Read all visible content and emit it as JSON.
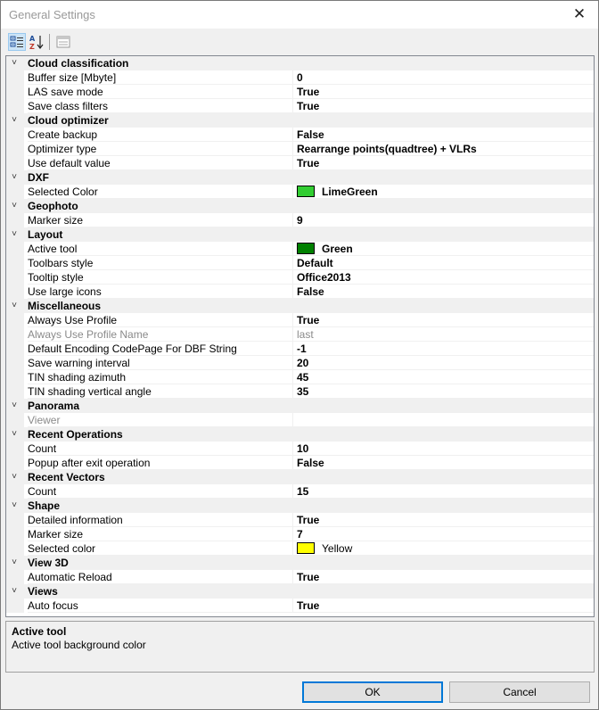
{
  "window": {
    "title": "General Settings"
  },
  "toolbar": {
    "categorized_tooltip": "",
    "alphabetical_tooltip": "",
    "pages_tooltip": ""
  },
  "categories": [
    {
      "name": "Cloud classification",
      "props": [
        {
          "name": "Buffer size [Mbyte]",
          "value": "0"
        },
        {
          "name": "LAS save mode",
          "value": "True"
        },
        {
          "name": "Save class filters",
          "value": "True"
        }
      ]
    },
    {
      "name": "Cloud optimizer",
      "props": [
        {
          "name": "Create backup",
          "value": "False"
        },
        {
          "name": "Optimizer type",
          "value": "Rearrange points(quadtree) + VLRs"
        },
        {
          "name": "Use default value",
          "value": "True"
        }
      ]
    },
    {
      "name": "DXF",
      "props": [
        {
          "name": "Selected Color",
          "value": "LimeGreen",
          "color": "#32cd32"
        }
      ]
    },
    {
      "name": "Geophoto",
      "props": [
        {
          "name": "Marker size",
          "value": "9"
        }
      ]
    },
    {
      "name": "Layout",
      "props": [
        {
          "name": "Active tool",
          "value": "Green",
          "color": "#008000"
        },
        {
          "name": "Toolbars style",
          "value": "Default"
        },
        {
          "name": "Tooltip style",
          "value": "Office2013"
        },
        {
          "name": "Use large icons",
          "value": "False"
        }
      ]
    },
    {
      "name": "Miscellaneous",
      "props": [
        {
          "name": "Always Use Profile",
          "value": "True"
        },
        {
          "name": "Always Use Profile Name",
          "value": "last",
          "disabled": true
        },
        {
          "name": "Default Encoding CodePage For DBF String",
          "value": "-1"
        },
        {
          "name": "Save warning interval",
          "value": "20"
        },
        {
          "name": "TIN shading azimuth",
          "value": "45"
        },
        {
          "name": "TIN shading vertical angle",
          "value": "35"
        }
      ]
    },
    {
      "name": "Panorama",
      "props": [
        {
          "name": "Viewer",
          "value": "",
          "disabled": true
        }
      ]
    },
    {
      "name": "Recent Operations",
      "props": [
        {
          "name": "Count",
          "value": "10"
        },
        {
          "name": "Popup after exit operation",
          "value": "False"
        }
      ]
    },
    {
      "name": "Recent Vectors",
      "props": [
        {
          "name": "Count",
          "value": "15"
        }
      ]
    },
    {
      "name": "Shape",
      "props": [
        {
          "name": "Detailed information",
          "value": "True"
        },
        {
          "name": "Marker size",
          "value": "7"
        },
        {
          "name": "Selected color",
          "value": "Yellow",
          "color": "#ffff00",
          "plain": true
        }
      ]
    },
    {
      "name": "View 3D",
      "props": [
        {
          "name": "Automatic Reload",
          "value": "True"
        }
      ]
    },
    {
      "name": "Views",
      "props": [
        {
          "name": "Auto focus",
          "value": "True"
        }
      ]
    }
  ],
  "description": {
    "title": "Active tool",
    "text": "Active tool background color"
  },
  "buttons": {
    "ok": "OK",
    "cancel": "Cancel"
  }
}
